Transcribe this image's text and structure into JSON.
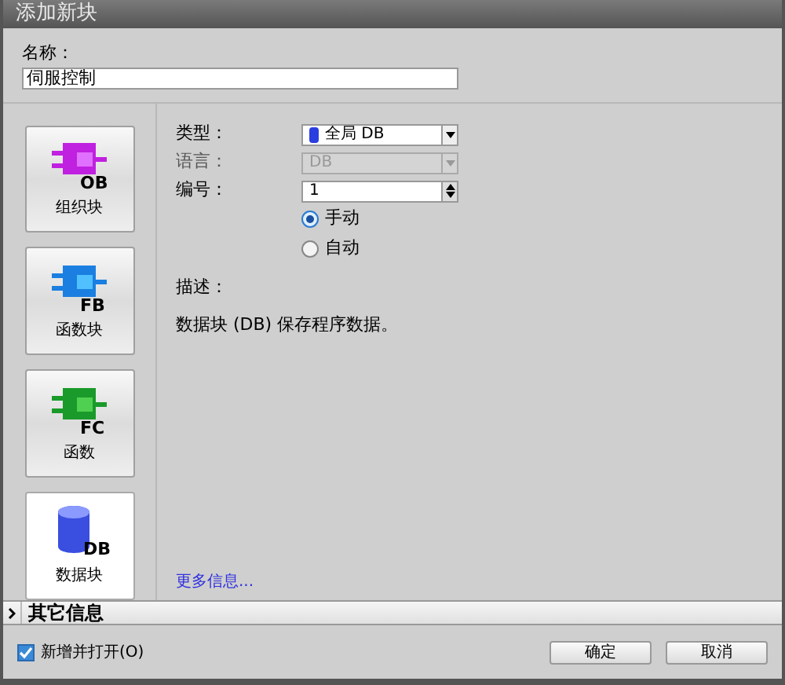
{
  "window": {
    "title": "添加新块"
  },
  "name": {
    "label": "名称：",
    "value": "伺服控制"
  },
  "block_types": [
    {
      "kind": "ob",
      "badge": "OB",
      "label": "组织块",
      "selected": false
    },
    {
      "kind": "fb",
      "badge": "FB",
      "label": "函数块",
      "selected": false
    },
    {
      "kind": "fc",
      "badge": "FC",
      "label": "函数",
      "selected": false
    },
    {
      "kind": "db",
      "badge": "DB",
      "label": "数据块",
      "selected": true
    }
  ],
  "type": {
    "label": "类型：",
    "value": "全局 DB"
  },
  "language": {
    "label": "语言：",
    "value": "DB",
    "disabled": true
  },
  "number": {
    "label": "编号：",
    "value": "1"
  },
  "numbering_modes": [
    {
      "label": "手动",
      "selected": true
    },
    {
      "label": "自动",
      "selected": false
    }
  ],
  "description": {
    "label": "描述：",
    "text": "数据块 (DB) 保存程序数据。"
  },
  "more_info_link": "更多信息...",
  "other_info": {
    "label": "其它信息",
    "expanded": false
  },
  "add_and_open": {
    "label": "新增并打开(O)",
    "checked": true
  },
  "buttons": [
    "确定",
    "取消"
  ]
}
